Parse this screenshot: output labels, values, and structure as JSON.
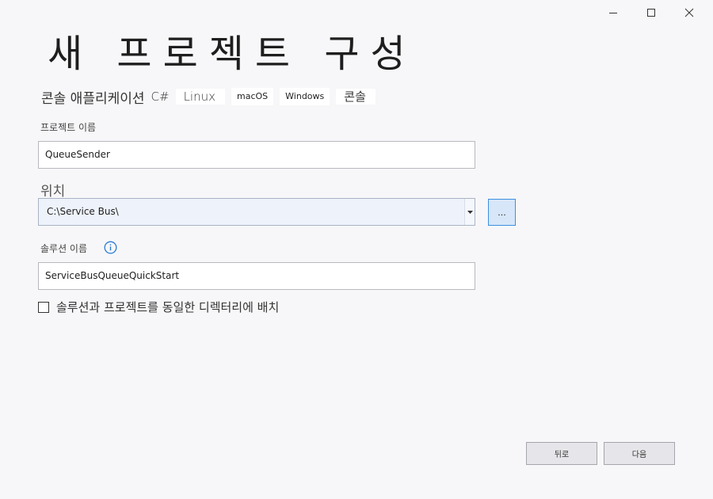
{
  "window": {
    "controls": [
      {
        "name": "minimize-icon"
      },
      {
        "name": "maximize-icon"
      },
      {
        "name": "close-icon"
      }
    ]
  },
  "page": {
    "title": "새 프로젝트 구성"
  },
  "template": {
    "name": "콘솔 애플리케이션",
    "language": "C#",
    "tags": [
      "Linux",
      "macOS",
      "Windows",
      "콘솔"
    ]
  },
  "project_name": {
    "label": "프로젝트 이름",
    "value": "QueueSender"
  },
  "location": {
    "label": "위치",
    "value": "C:\\Service Bus\\",
    "browse_label": "..."
  },
  "solution_name": {
    "label": "솔루션 이름",
    "value": "ServiceBusQueueQuickStart",
    "info_icon": "info-icon"
  },
  "same_directory": {
    "label": "솔루션과 프로젝트를 동일한 디렉터리에 배치",
    "checked": false
  },
  "footer": {
    "back_label": "뒤로",
    "next_label": "다음"
  }
}
